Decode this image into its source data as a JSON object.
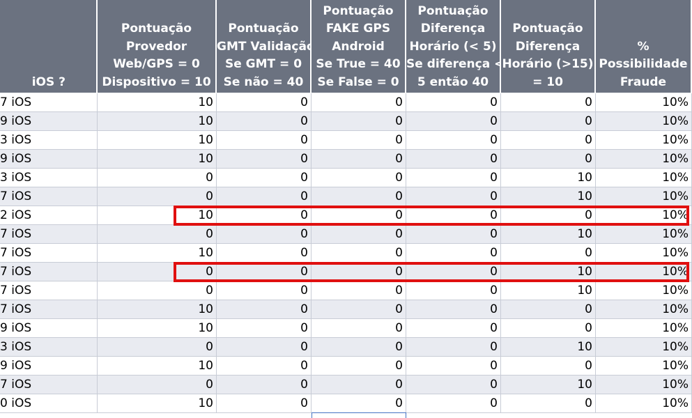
{
  "headers": [
    {
      "id": "col-ios",
      "lines": [
        "iOS ?"
      ]
    },
    {
      "id": "col-provedor",
      "lines": [
        "Pontuação",
        "Provedor",
        "Web/GPS = 0",
        "Dispositivo = 10"
      ]
    },
    {
      "id": "col-gmt",
      "lines": [
        "Pontuação",
        "GMT Validação",
        "Se GMT = 0",
        "Se não = 40"
      ]
    },
    {
      "id": "col-fakegps",
      "lines": [
        "Pontuação",
        "FAKE GPS",
        "Android",
        "Se True = 40",
        "Se False = 0"
      ]
    },
    {
      "id": "col-dif-menor5",
      "lines": [
        "Pontuação",
        "Diferença",
        "Horário  (< 5)",
        "Se diferença <",
        "5 então 40"
      ]
    },
    {
      "id": "col-dif-maior15",
      "lines": [
        "Pontuação",
        "Diferença",
        "Horário (>15)",
        "= 10"
      ]
    },
    {
      "id": "col-possibilidade",
      "lines": [
        "%",
        "Possibilidade",
        "Fraude"
      ]
    }
  ],
  "rows": [
    [
      "7 iOS",
      "10",
      "0",
      "0",
      "0",
      "0",
      "10%"
    ],
    [
      "9 iOS",
      "10",
      "0",
      "0",
      "0",
      "0",
      "10%"
    ],
    [
      "3 iOS",
      "10",
      "0",
      "0",
      "0",
      "0",
      "10%"
    ],
    [
      "9 iOS",
      "10",
      "0",
      "0",
      "0",
      "0",
      "10%"
    ],
    [
      "3 iOS",
      "0",
      "0",
      "0",
      "0",
      "10",
      "10%"
    ],
    [
      "7 iOS",
      "0",
      "0",
      "0",
      "0",
      "10",
      "10%"
    ],
    [
      "2 iOS",
      "10",
      "0",
      "0",
      "0",
      "0",
      "10%"
    ],
    [
      "7 iOS",
      "0",
      "0",
      "0",
      "0",
      "10",
      "10%"
    ],
    [
      "7 iOS",
      "10",
      "0",
      "0",
      "0",
      "0",
      "10%"
    ],
    [
      "7 iOS",
      "0",
      "0",
      "0",
      "0",
      "10",
      "10%"
    ],
    [
      "7 iOS",
      "0",
      "0",
      "0",
      "0",
      "10",
      "10%"
    ],
    [
      "7 iOS",
      "10",
      "0",
      "0",
      "0",
      "0",
      "10%"
    ],
    [
      "9 iOS",
      "10",
      "0",
      "0",
      "0",
      "0",
      "10%"
    ],
    [
      "3 iOS",
      "0",
      "0",
      "0",
      "0",
      "10",
      "10%"
    ],
    [
      "9 iOS",
      "10",
      "0",
      "0",
      "0",
      "0",
      "10%"
    ],
    [
      "7 iOS",
      "0",
      "0",
      "0",
      "0",
      "10",
      "10%"
    ],
    [
      "0 iOS",
      "10",
      "0",
      "0",
      "0",
      "0",
      "10%"
    ]
  ],
  "highlighted_rows": [
    6,
    9
  ],
  "colors": {
    "header_bg": "#6b7280",
    "header_text": "#ffffff",
    "band_row": "#e9ebf1",
    "gridline": "#c8ccd6",
    "highlight_border": "#e01010",
    "selection_border": "#4472c4"
  }
}
